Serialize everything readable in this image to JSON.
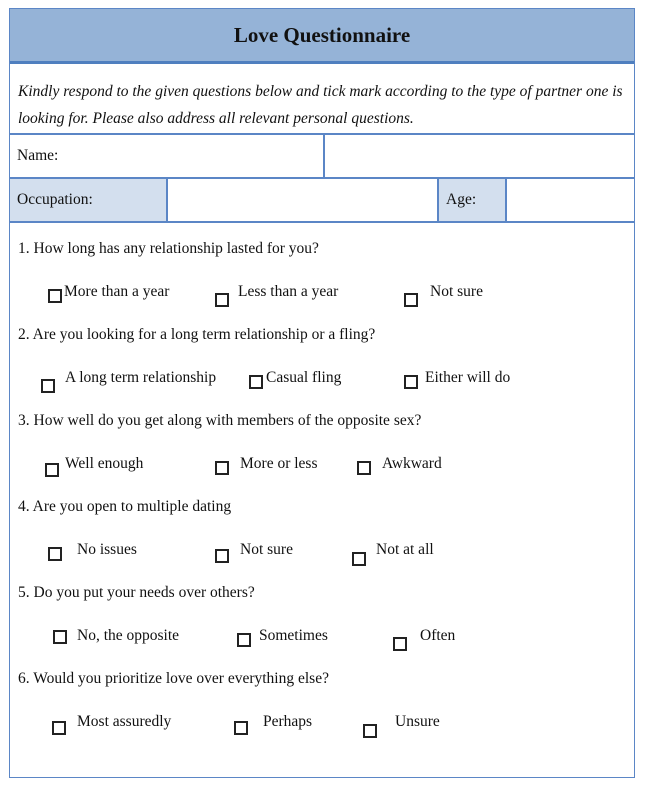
{
  "title": "Love Questionnaire",
  "intro": "Kindly respond to the given questions below and tick mark according to the type of partner one is looking for. Please also address all relevant personal questions.",
  "fields": {
    "name_label": "Name:",
    "name_value": "",
    "occupation_label": "Occupation:",
    "occupation_value": "",
    "age_label": "Age:",
    "age_value": ""
  },
  "colors": {
    "header_bg": "#95b3d7",
    "border": "#5b86c6",
    "label_bg": "#d3dfee"
  },
  "questions": [
    {
      "text": "1. How long has any relationship lasted for you?",
      "options": [
        "More than a year",
        "Less than a year",
        "Not sure"
      ]
    },
    {
      "text": "2. Are you looking for a long term relationship or a fling?",
      "options": [
        "A long term relationship",
        "Casual fling",
        "Either will do"
      ]
    },
    {
      "text": "3. How well do you get along with members of the opposite sex?",
      "options": [
        "Well enough",
        "More or less",
        "Awkward"
      ]
    },
    {
      "text": "4. Are you open to multiple dating",
      "options": [
        "No issues",
        "Not sure",
        "Not at all"
      ]
    },
    {
      "text": "5. Do you put your needs over others?",
      "options": [
        "No, the opposite",
        "Sometimes",
        "Often"
      ]
    },
    {
      "text": "6. Would you prioritize love over everything else?",
      "options": [
        "Most assuredly",
        "Perhaps",
        "Unsure"
      ]
    }
  ]
}
